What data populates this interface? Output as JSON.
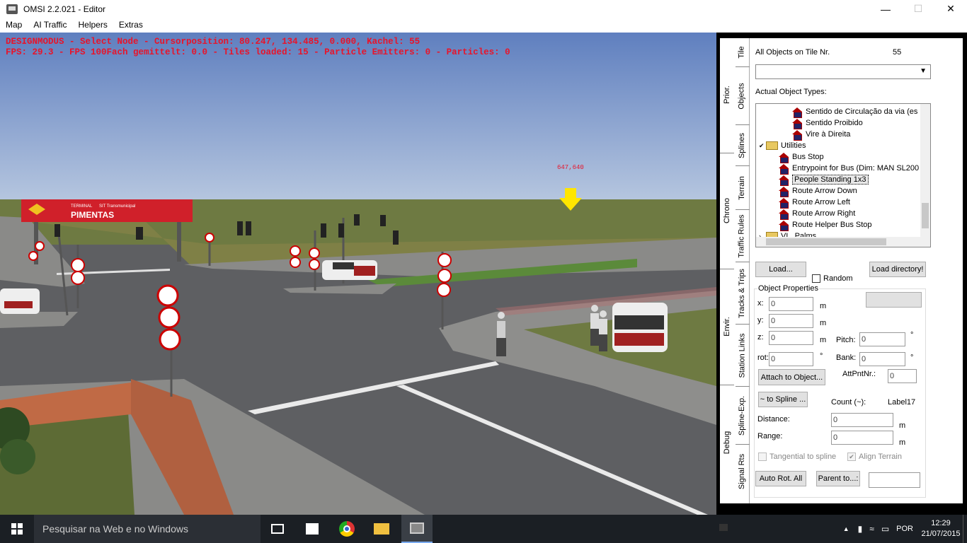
{
  "window": {
    "title": "OMSI 2.2.021 - Editor"
  },
  "menu": [
    "Map",
    "AI Traffic",
    "Helpers",
    "Extras"
  ],
  "hud": {
    "line1": "DESIGNMODUS - Select Node - Cursorposition: 80.247, 134.485, 0.000, Kachel: 55",
    "line2": "FPS: 29.3 - FPS 100Fach gemittelt: 0.0 - Tiles loaded: 15 - Particle Emitters: 0 - Particles: 0",
    "cursor_label": "647,640"
  },
  "scene": {
    "sign_title": "PIMENTAS",
    "sign_small": "TERMINAL",
    "sign_sub": "SIT Transmunicipal"
  },
  "tabs": {
    "right_col": [
      "Tile",
      "Objects",
      "Splines",
      "Terrain",
      "Traffic Rules",
      "Tracks & Trips",
      "Station Links",
      "Spline-Exp.",
      "Signal Rts"
    ],
    "left_col": [
      "Prior.",
      "Chrono",
      "Envir.",
      "Debug"
    ]
  },
  "objects_panel": {
    "all_objects_label": "All Objects on Tile Nr.",
    "tile_number": "55",
    "actual_types_label": "Actual Object Types:",
    "tree": [
      {
        "label": "Sentido de Circulação da via (es",
        "type": "object",
        "indent": 2
      },
      {
        "label": "Sentido Proibido",
        "type": "object",
        "indent": 2
      },
      {
        "label": "Vire à Direita",
        "type": "object",
        "indent": 2
      },
      {
        "label": "Utilities",
        "type": "folder",
        "indent": 1,
        "expanded": true
      },
      {
        "label": "Bus Stop",
        "type": "object",
        "indent": 2
      },
      {
        "label": "Entrypoint for Bus (Dim: MAN SL200",
        "type": "object",
        "indent": 2
      },
      {
        "label": "People Standing 1x3",
        "type": "object",
        "indent": 2,
        "selected": true
      },
      {
        "label": "Route Arrow Down",
        "type": "object",
        "indent": 2
      },
      {
        "label": "Route Arrow Left",
        "type": "object",
        "indent": 2
      },
      {
        "label": "Route Arrow Right",
        "type": "object",
        "indent": 2
      },
      {
        "label": "Route Helper Bus Stop",
        "type": "object",
        "indent": 2
      },
      {
        "label": "VL_Palms",
        "type": "folder",
        "indent": 1,
        "expanded": false
      }
    ],
    "load_button": "Load...",
    "random_label": "Random",
    "load_directory_button": "Load directory!",
    "props_title": "Object Properties",
    "x_label": "x:",
    "y_label": "y:",
    "z_label": "z:",
    "rot_label": "rot:",
    "x": "0",
    "y": "0",
    "z": "0",
    "rot": "0",
    "unit_m": "m",
    "unit_deg": "°",
    "pitch_label": "Pitch:",
    "pitch": "0",
    "bank_label": "Bank:",
    "bank": "0",
    "attpnt_label": "AttPntNr.:",
    "attpnt": "0",
    "attach_button": "Attach to Object...",
    "to_spline_button": "~ to Spline ...",
    "count_label": "Count (~):",
    "count_value": "Label17",
    "distance_label": "Distance:",
    "distance": "0",
    "range_label": "Range:",
    "range": "0",
    "tangential_label": "Tangential to spline",
    "align_terrain_label": "Align Terrain",
    "auto_rot_button": "Auto Rot. All",
    "parent_button": "Parent to...:"
  },
  "taskbar": {
    "search_placeholder": "Pesquisar na Web e no Windows",
    "language": "POR",
    "time": "12:29",
    "date": "21/07/2015"
  },
  "colors": {
    "hud": "#e8142a",
    "taskbar": "#1b1f24",
    "grass": "#6e7a42",
    "road": "#5e5f62"
  }
}
